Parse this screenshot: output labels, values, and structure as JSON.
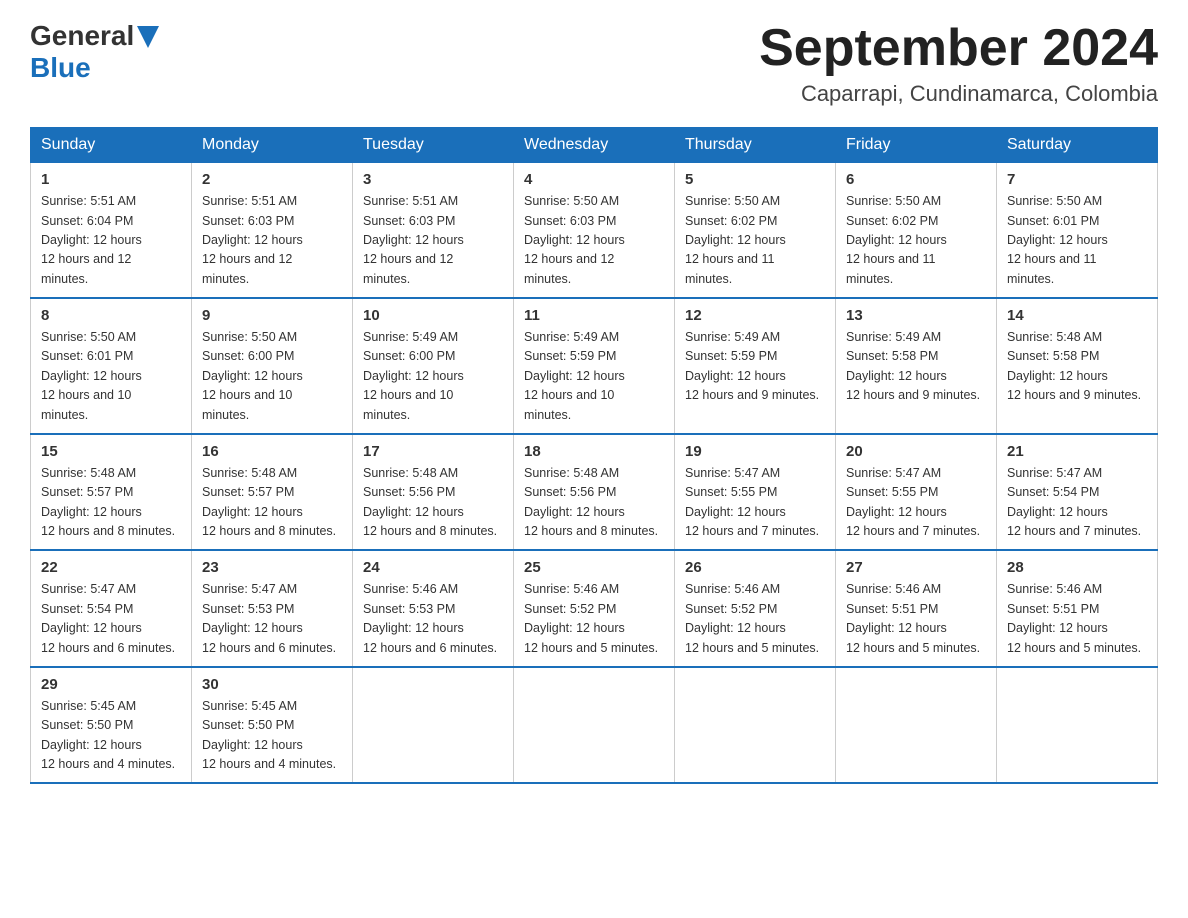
{
  "header": {
    "logo_general": "General",
    "logo_blue": "Blue",
    "month_year": "September 2024",
    "location": "Caparrapi, Cundinamarca, Colombia"
  },
  "days_of_week": [
    "Sunday",
    "Monday",
    "Tuesday",
    "Wednesday",
    "Thursday",
    "Friday",
    "Saturday"
  ],
  "weeks": [
    [
      {
        "day": "1",
        "sunrise": "5:51 AM",
        "sunset": "6:04 PM",
        "daylight": "12 hours and 12 minutes."
      },
      {
        "day": "2",
        "sunrise": "5:51 AM",
        "sunset": "6:03 PM",
        "daylight": "12 hours and 12 minutes."
      },
      {
        "day": "3",
        "sunrise": "5:51 AM",
        "sunset": "6:03 PM",
        "daylight": "12 hours and 12 minutes."
      },
      {
        "day": "4",
        "sunrise": "5:50 AM",
        "sunset": "6:03 PM",
        "daylight": "12 hours and 12 minutes."
      },
      {
        "day": "5",
        "sunrise": "5:50 AM",
        "sunset": "6:02 PM",
        "daylight": "12 hours and 11 minutes."
      },
      {
        "day": "6",
        "sunrise": "5:50 AM",
        "sunset": "6:02 PM",
        "daylight": "12 hours and 11 minutes."
      },
      {
        "day": "7",
        "sunrise": "5:50 AM",
        "sunset": "6:01 PM",
        "daylight": "12 hours and 11 minutes."
      }
    ],
    [
      {
        "day": "8",
        "sunrise": "5:50 AM",
        "sunset": "6:01 PM",
        "daylight": "12 hours and 10 minutes."
      },
      {
        "day": "9",
        "sunrise": "5:50 AM",
        "sunset": "6:00 PM",
        "daylight": "12 hours and 10 minutes."
      },
      {
        "day": "10",
        "sunrise": "5:49 AM",
        "sunset": "6:00 PM",
        "daylight": "12 hours and 10 minutes."
      },
      {
        "day": "11",
        "sunrise": "5:49 AM",
        "sunset": "5:59 PM",
        "daylight": "12 hours and 10 minutes."
      },
      {
        "day": "12",
        "sunrise": "5:49 AM",
        "sunset": "5:59 PM",
        "daylight": "12 hours and 9 minutes."
      },
      {
        "day": "13",
        "sunrise": "5:49 AM",
        "sunset": "5:58 PM",
        "daylight": "12 hours and 9 minutes."
      },
      {
        "day": "14",
        "sunrise": "5:48 AM",
        "sunset": "5:58 PM",
        "daylight": "12 hours and 9 minutes."
      }
    ],
    [
      {
        "day": "15",
        "sunrise": "5:48 AM",
        "sunset": "5:57 PM",
        "daylight": "12 hours and 8 minutes."
      },
      {
        "day": "16",
        "sunrise": "5:48 AM",
        "sunset": "5:57 PM",
        "daylight": "12 hours and 8 minutes."
      },
      {
        "day": "17",
        "sunrise": "5:48 AM",
        "sunset": "5:56 PM",
        "daylight": "12 hours and 8 minutes."
      },
      {
        "day": "18",
        "sunrise": "5:48 AM",
        "sunset": "5:56 PM",
        "daylight": "12 hours and 8 minutes."
      },
      {
        "day": "19",
        "sunrise": "5:47 AM",
        "sunset": "5:55 PM",
        "daylight": "12 hours and 7 minutes."
      },
      {
        "day": "20",
        "sunrise": "5:47 AM",
        "sunset": "5:55 PM",
        "daylight": "12 hours and 7 minutes."
      },
      {
        "day": "21",
        "sunrise": "5:47 AM",
        "sunset": "5:54 PM",
        "daylight": "12 hours and 7 minutes."
      }
    ],
    [
      {
        "day": "22",
        "sunrise": "5:47 AM",
        "sunset": "5:54 PM",
        "daylight": "12 hours and 6 minutes."
      },
      {
        "day": "23",
        "sunrise": "5:47 AM",
        "sunset": "5:53 PM",
        "daylight": "12 hours and 6 minutes."
      },
      {
        "day": "24",
        "sunrise": "5:46 AM",
        "sunset": "5:53 PM",
        "daylight": "12 hours and 6 minutes."
      },
      {
        "day": "25",
        "sunrise": "5:46 AM",
        "sunset": "5:52 PM",
        "daylight": "12 hours and 5 minutes."
      },
      {
        "day": "26",
        "sunrise": "5:46 AM",
        "sunset": "5:52 PM",
        "daylight": "12 hours and 5 minutes."
      },
      {
        "day": "27",
        "sunrise": "5:46 AM",
        "sunset": "5:51 PM",
        "daylight": "12 hours and 5 minutes."
      },
      {
        "day": "28",
        "sunrise": "5:46 AM",
        "sunset": "5:51 PM",
        "daylight": "12 hours and 5 minutes."
      }
    ],
    [
      {
        "day": "29",
        "sunrise": "5:45 AM",
        "sunset": "5:50 PM",
        "daylight": "12 hours and 4 minutes."
      },
      {
        "day": "30",
        "sunrise": "5:45 AM",
        "sunset": "5:50 PM",
        "daylight": "12 hours and 4 minutes."
      },
      null,
      null,
      null,
      null,
      null
    ]
  ]
}
